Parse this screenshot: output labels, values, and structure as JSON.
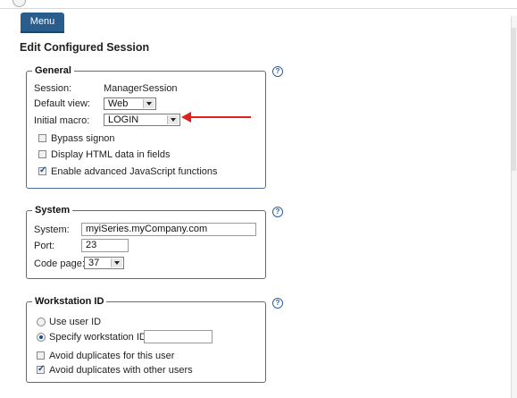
{
  "menu": {
    "label": "Menu"
  },
  "page": {
    "title": "Edit Configured Session"
  },
  "general": {
    "legend": "General",
    "help": "?",
    "session_label": "Session:",
    "session_value": "ManagerSession",
    "default_view_label": "Default view:",
    "default_view_value": "Web",
    "initial_macro_label": "Initial macro:",
    "initial_macro_value": "LOGIN",
    "bypass_signon": {
      "label": "Bypass signon",
      "checked": false
    },
    "display_html": {
      "label": "Display HTML data in fields",
      "checked": false
    },
    "enable_js": {
      "label": "Enable advanced JavaScript functions",
      "checked": true
    }
  },
  "system": {
    "legend": "System",
    "help": "?",
    "system_label": "System:",
    "system_value": "myiSeries.myCompany.com",
    "port_label": "Port:",
    "port_value": "23",
    "code_page_label": "Code page:",
    "code_page_value": "37"
  },
  "workstation": {
    "legend": "Workstation ID",
    "help": "?",
    "use_user_id": {
      "label": "Use user ID",
      "selected": false
    },
    "specify_id": {
      "label": "Specify workstation ID",
      "selected": true
    },
    "specify_value": "",
    "avoid_dup_user": {
      "label": "Avoid duplicates for this user",
      "checked": false
    },
    "avoid_dup_others": {
      "label": "Avoid duplicates with other users",
      "checked": true
    }
  },
  "colors": {
    "accent": "#2a5d8c",
    "annotation_arrow": "#e0201c",
    "fieldset_border": "#4a6f9a"
  }
}
